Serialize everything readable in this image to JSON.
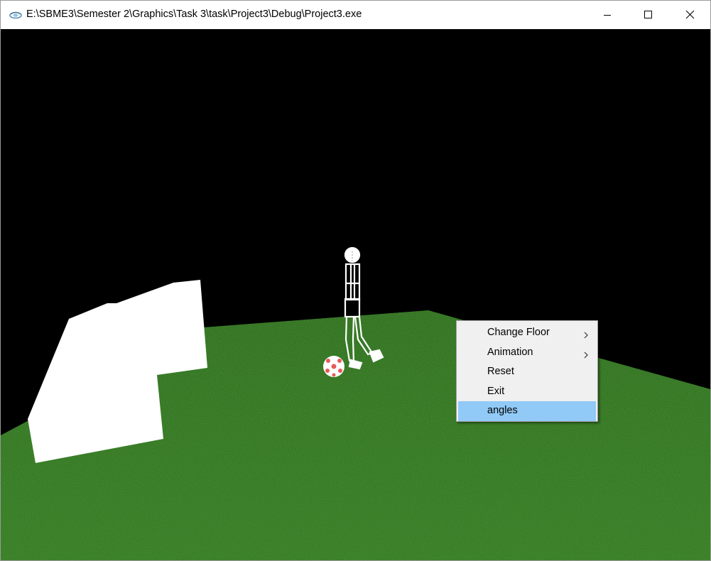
{
  "window": {
    "title": "E:\\SBME3\\Semester 2\\Graphics\\Task 3\\task\\Project3\\Debug\\Project3.exe",
    "icon": "opengl-app-icon",
    "controls": [
      "minimize-icon",
      "maximize-icon",
      "close-icon"
    ]
  },
  "scene": {
    "background_color": "#000000",
    "floor_texture": "grass",
    "floor_color": "#2f6b1f",
    "objects": [
      "goal-post",
      "stick-figure-player",
      "soccer-ball"
    ]
  },
  "context_menu": {
    "items": [
      {
        "label": "Change Floor",
        "has_submenu": true
      },
      {
        "label": "Animation",
        "has_submenu": true
      },
      {
        "label": "Reset",
        "has_submenu": false
      },
      {
        "label": "Exit",
        "has_submenu": false
      },
      {
        "label": "angles",
        "has_submenu": false,
        "highlighted": true
      }
    ],
    "highlight_color": "#91c9f7"
  }
}
